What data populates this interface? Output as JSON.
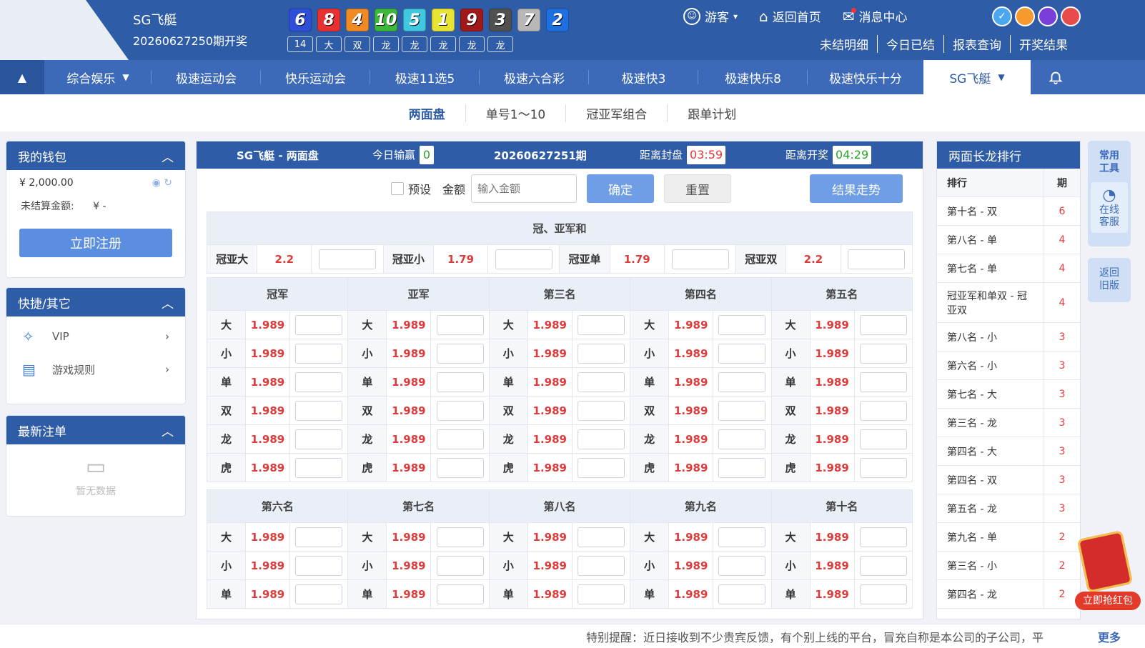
{
  "header": {
    "game_name": "SG飞艇",
    "last_issue": "20260627250期开奖",
    "balls": [
      {
        "num": "6",
        "color": "#2d4ed6"
      },
      {
        "num": "8",
        "color": "#e93030"
      },
      {
        "num": "4",
        "color": "#f08a24"
      },
      {
        "num": "10",
        "color": "#3fb83a"
      },
      {
        "num": "5",
        "color": "#40c8e0"
      },
      {
        "num": "1",
        "color": "#e8e434"
      },
      {
        "num": "9",
        "color": "#a01818"
      },
      {
        "num": "3",
        "color": "#505050"
      },
      {
        "num": "7",
        "color": "#b8b8b8"
      },
      {
        "num": "2",
        "color": "#1e6fe0"
      }
    ],
    "tags": [
      "14",
      "大",
      "双",
      "龙",
      "龙",
      "龙",
      "龙",
      "龙"
    ],
    "user": "游客",
    "home": "返回首页",
    "messages": "消息中心",
    "theme_colors": [
      "#4aa8f0",
      "#f59b2e",
      "#7b3fd9",
      "#e94a4a"
    ],
    "sub_links": [
      "未结明细",
      "今日已结",
      "报表查询",
      "开奖结果"
    ]
  },
  "nav": {
    "items": [
      "综合娱乐",
      "极速运动会",
      "快乐运动会",
      "极速11选5",
      "极速六合彩",
      "极速快3",
      "极速快乐8",
      "极速快乐十分",
      "SG飞艇"
    ]
  },
  "subnav": [
    "两面盘",
    "单号1～10",
    "冠亚军组合",
    "跟单计划"
  ],
  "wallet": {
    "title": "我的钱包",
    "balance": "¥ 2,000.00",
    "unsettled_label": "未结算金额:",
    "unsettled_value": "¥ -",
    "register": "立即注册"
  },
  "shortcuts": {
    "title": "快捷/其它",
    "items": [
      "VIP",
      "游戏规则"
    ]
  },
  "latest": {
    "title": "最新注单",
    "empty": "暂无数据"
  },
  "center": {
    "title": "SG飞艇 - 两面盘",
    "today_label": "今日输赢",
    "today_value": "0",
    "issue": "20260627251期",
    "close_label": "距离封盘",
    "close_time": "03:59",
    "draw_label": "距离开奖",
    "draw_time": "04:29",
    "preset": "预设",
    "amount_label": "金额",
    "amount_placeholder": "输入金额",
    "confirm": "确定",
    "reset": "重置",
    "trend": "结果走势",
    "sum_title": "冠、亚军和",
    "sum_items": [
      {
        "label": "冠亚大",
        "odds": "2.2"
      },
      {
        "label": "冠亚小",
        "odds": "1.79"
      },
      {
        "label": "冠亚单",
        "odds": "1.79"
      },
      {
        "label": "冠亚双",
        "odds": "2.2"
      }
    ],
    "group1": [
      "冠军",
      "亚军",
      "第三名",
      "第四名",
      "第五名"
    ],
    "group2": [
      "第六名",
      "第七名",
      "第八名",
      "第九名",
      "第十名"
    ],
    "options": [
      "大",
      "小",
      "单",
      "双",
      "龙",
      "虎"
    ],
    "group2_options": [
      "大",
      "小",
      "单"
    ],
    "odds": "1.989"
  },
  "ranking": {
    "title": "两面长龙排行",
    "col_rank": "排行",
    "col_period": "期",
    "rows": [
      {
        "name": "第十名 - 双",
        "n": "6"
      },
      {
        "name": "第八名 - 单",
        "n": "4"
      },
      {
        "name": "第七名 - 单",
        "n": "4"
      },
      {
        "name": "冠亚军和单双 - 冠亚双",
        "n": "4"
      },
      {
        "name": "第八名 - 小",
        "n": "3"
      },
      {
        "name": "第六名 - 小",
        "n": "3"
      },
      {
        "name": "第七名 - 大",
        "n": "3"
      },
      {
        "name": "第三名 - 龙",
        "n": "3"
      },
      {
        "name": "第四名 - 大",
        "n": "3"
      },
      {
        "name": "第四名 - 双",
        "n": "3"
      },
      {
        "name": "第五名 - 龙",
        "n": "3"
      },
      {
        "name": "第九名 - 单",
        "n": "2"
      },
      {
        "name": "第三名 - 小",
        "n": "2"
      },
      {
        "name": "第四名 - 龙",
        "n": "2"
      }
    ]
  },
  "side": {
    "tools": "常用工具",
    "service": "在线客服",
    "old": "返回旧版",
    "redpacket": "立即抢红包"
  },
  "marquee": {
    "text": "特别提醒：近日接收到不少贵宾反馈，有个别上线的平台，冒充自称是本公司的子公司，平",
    "more": "更多"
  }
}
